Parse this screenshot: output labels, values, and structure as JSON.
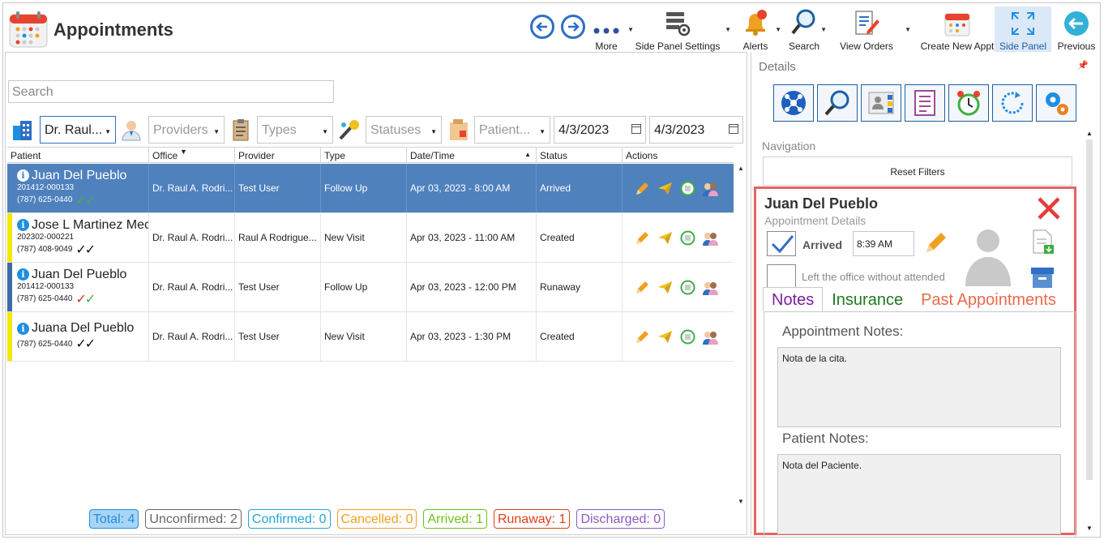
{
  "app": {
    "title": "Appointments",
    "toolbar": {
      "more": "More",
      "side_panel_settings": "Side Panel Settings",
      "alerts": "Alerts",
      "search": "Search",
      "view_orders": "View Orders",
      "create_new_appt": "Create New Appt",
      "side_panel": "Side Panel",
      "previous": "Previous"
    }
  },
  "search": {
    "placeholder": "Search"
  },
  "filters": {
    "office": "Dr. Raul...",
    "providers": "Providers",
    "types": "Types",
    "statuses": "Statuses",
    "patient": "Patient...",
    "date_from": "4/3/2023",
    "date_to": "4/3/2023"
  },
  "grid": {
    "columns": [
      "Patient",
      "Office",
      "Provider",
      "Type",
      "Date/Time",
      "Status",
      "Actions"
    ],
    "rows": [
      {
        "name": "Juan Del Pueblo",
        "case": "201412-000133",
        "phone": "(787) 625-0440",
        "office": "Dr. Raul A. Rodri...",
        "provider": "Test User",
        "type": "Follow Up",
        "datetime": "Apr 03, 2023 - 8:00 AM",
        "status": "Arrived",
        "stripe": "#4f81bd",
        "check1": "#3cb043",
        "check2": "#3cb043"
      },
      {
        "name": "Jose L Martinez Mec",
        "case": "202302-000221",
        "phone": "(787) 408-9049",
        "office": "Dr. Raul A. Rodri...",
        "provider": "Raul A Rodrigue...",
        "type": "New Visit",
        "datetime": "Apr 03, 2023 - 11:00 AM",
        "status": "Created",
        "stripe": "#f5e800",
        "check1": "#111111",
        "check2": "#111111"
      },
      {
        "name": "Juan Del Pueblo",
        "case": "201412-000133",
        "phone": "(787) 625-0440",
        "office": "Dr. Raul A. Rodri...",
        "provider": "Test User",
        "type": "Follow Up",
        "datetime": "Apr 03, 2023 - 12:00 PM",
        "status": "Runaway",
        "stripe": "#3e6aa6",
        "check1": "#e03030",
        "check2": "#3cb043"
      },
      {
        "name": "Juana Del Pueblo",
        "case": "",
        "phone": "(787) 625-0440",
        "office": "Dr. Raul A. Rodri...",
        "provider": "Test User",
        "type": "New Visit",
        "datetime": "Apr 03, 2023 - 1:30 PM",
        "status": "Created",
        "stripe": "#f5e800",
        "check1": "#111111",
        "check2": "#111111"
      }
    ]
  },
  "counters": [
    {
      "label": "Total: 4",
      "color": "#1f8fe0",
      "bg": "#a9d4f5"
    },
    {
      "label": "Unconfirmed: 2",
      "color": "#666666",
      "bg": "#ffffff"
    },
    {
      "label": "Confirmed: 0",
      "color": "#23a5d6",
      "bg": "#ffffff"
    },
    {
      "label": "Cancelled: 0",
      "color": "#f0a020",
      "bg": "#ffffff"
    },
    {
      "label": "Arrived: 1",
      "color": "#6ec21a",
      "bg": "#ffffff"
    },
    {
      "label": "Runaway: 1",
      "color": "#e0401a",
      "bg": "#ffffff"
    },
    {
      "label": "Discharged: 0",
      "color": "#8a5cc0",
      "bg": "#ffffff"
    }
  ],
  "details": {
    "title": "Details",
    "navigation": "Navigation",
    "reset_filters": "Reset Filters",
    "patient_name": "Juan Del Pueblo",
    "subtitle": "Appointment Details",
    "arrived_label": "Arrived",
    "arrived_time": "8:39 AM",
    "left_office_label": "Left the office without attended",
    "tabs": [
      {
        "label": "Notes",
        "color": "#7a1fa0"
      },
      {
        "label": "Insurance",
        "color": "#1f7a1f"
      },
      {
        "label": "Past Appointments",
        "color": "#e86a4a"
      }
    ],
    "appointment_notes_label": "Appointment Notes:",
    "appointment_notes": "Nota de la cita.",
    "patient_notes_label": "Patient Notes:",
    "patient_notes": "Nota del Paciente."
  },
  "icons": [
    "calendar-icon",
    "back-arrow-icon",
    "forward-arrow-icon",
    "more-dots-icon",
    "settings-grid-icon",
    "bell-icon",
    "magnifier-icon",
    "orders-icon",
    "new-appt-icon",
    "expand-icon",
    "previous-icon"
  ]
}
